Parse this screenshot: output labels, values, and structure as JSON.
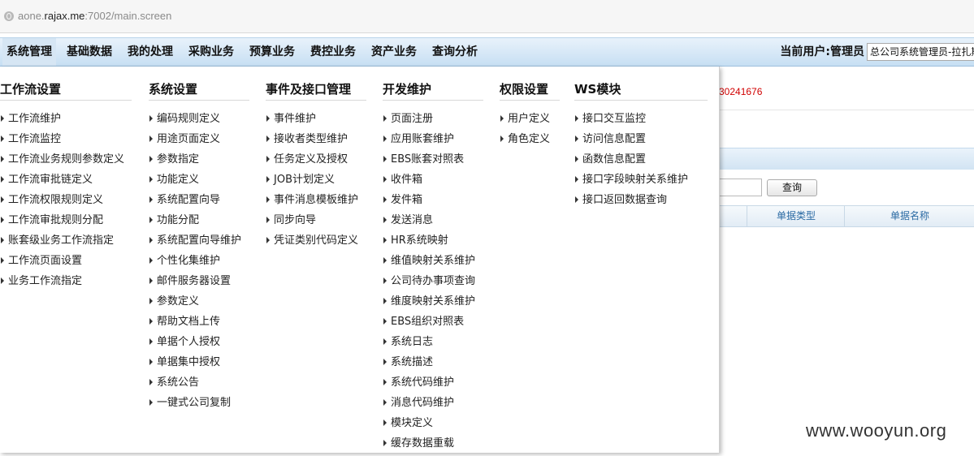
{
  "browser": {
    "url_prefix": "aone.",
    "url_domain": "rajax.me",
    "url_suffix": ":7002/main.screen",
    "globe_icon": "globe-icon"
  },
  "menubar": {
    "items": [
      "系统管理",
      "基础数据",
      "我的处理",
      "采购业务",
      "预算业务",
      "费控业务",
      "资产业务",
      "查询分析"
    ],
    "user_label": "当前用户:管理员",
    "user_select_value": "总公司系统管理员-拉扎斯"
  },
  "background": {
    "red_number": "30241676",
    "query_button": "查询",
    "grid_headers": [
      "单据类型",
      "单据名称"
    ],
    "watermark": "www.wooyun.org"
  },
  "dropdown": {
    "columns": [
      {
        "title": "工作流设置",
        "items": [
          "工作流维护",
          "工作流监控",
          "工作流业务规则参数定义",
          "工作流审批链定义",
          "工作流权限规则定义",
          "工作流审批规则分配",
          "账套级业务工作流指定",
          "工作流页面设置",
          "业务工作流指定"
        ]
      },
      {
        "title": "系统设置",
        "items": [
          "编码规则定义",
          "用途页面定义",
          "参数指定",
          "功能定义",
          "系统配置向导",
          "功能分配",
          "系统配置向导维护",
          "个性化集维护",
          "邮件服务器设置",
          "参数定义",
          "帮助文档上传",
          "单据个人授权",
          "单据集中授权",
          "系统公告",
          "一键式公司复制"
        ]
      },
      {
        "title": "事件及接口管理",
        "items": [
          "事件维护",
          "接收者类型维护",
          "任务定义及授权",
          "JOB计划定义",
          "事件消息模板维护",
          "同步向导",
          "凭证类别代码定义"
        ]
      },
      {
        "title": "开发维护",
        "items": [
          "页面注册",
          "应用账套维护",
          "EBS账套对照表",
          "收件箱",
          "发件箱",
          "发送消息",
          "HR系统映射",
          "维值映射关系维护",
          "公司待办事项查询",
          "维度映射关系维护",
          "EBS组织对照表",
          "系统日志",
          "系统描述",
          "系统代码维护",
          "消息代码维护",
          "模块定义",
          "缓存数据重载"
        ]
      },
      {
        "title": "权限设置",
        "items": [
          "用户定义",
          "角色定义"
        ]
      },
      {
        "title": "WS模块",
        "items": [
          "接口交互监控",
          "访问信息配置",
          "函数信息配置",
          "接口字段映射关系维护",
          "接口返回数据查询"
        ]
      }
    ]
  }
}
